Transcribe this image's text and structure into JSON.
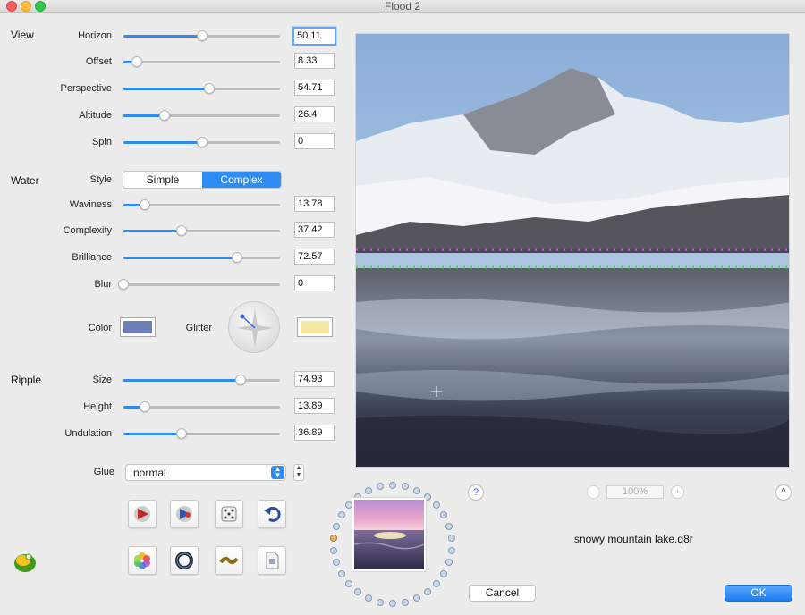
{
  "window": {
    "title": "Flood 2"
  },
  "view": {
    "section_label": "View",
    "rows": [
      {
        "label": "Horizon",
        "value": "50.11",
        "fraction": 0.5011
      },
      {
        "label": "Offset",
        "value": "8.33",
        "fraction": 0.0833
      },
      {
        "label": "Perspective",
        "value": "54.71",
        "fraction": 0.5471
      },
      {
        "label": "Altitude",
        "value": "26.4",
        "fraction": 0.264
      },
      {
        "label": "Spin",
        "value": "0",
        "fraction": 0.5
      }
    ]
  },
  "water": {
    "section_label": "Water",
    "style_label": "Style",
    "style_options": [
      "Simple",
      "Complex"
    ],
    "style_selected": "Complex",
    "rows": [
      {
        "label": "Waviness",
        "value": "13.78",
        "fraction": 0.1378
      },
      {
        "label": "Complexity",
        "value": "37.42",
        "fraction": 0.3742
      },
      {
        "label": "Brilliance",
        "value": "72.57",
        "fraction": 0.7257
      },
      {
        "label": "Blur",
        "value": "0",
        "fraction": 0.0
      }
    ],
    "color_label": "Color",
    "color_value": "#6f7fb8",
    "glitter_label": "Glitter",
    "glitter_value": "#f3eba4"
  },
  "ripple": {
    "section_label": "Ripple",
    "rows": [
      {
        "label": "Size",
        "value": "74.93",
        "fraction": 0.7493
      },
      {
        "label": "Height",
        "value": "13.89",
        "fraction": 0.1389
      },
      {
        "label": "Undulation",
        "value": "36.89",
        "fraction": 0.3689
      }
    ]
  },
  "glue": {
    "label": "Glue",
    "value": "normal"
  },
  "toolbar": {
    "icons": [
      "random-red-icon",
      "random-blue-icon",
      "dice-icon",
      "undo-icon",
      "photos-icon",
      "ring-icon",
      "wave-icon",
      "file-icon"
    ]
  },
  "preview": {
    "help": "?",
    "zoom": "100%",
    "collapse": "^"
  },
  "preset": {
    "filename": "snowy mountain lake.q8r",
    "dot_count": 30,
    "selected_dot": 23
  },
  "buttons": {
    "cancel": "Cancel",
    "ok": "OK"
  },
  "colors": {
    "accent": "#2f8cf5",
    "horizon_line": "#e040e0",
    "offset_line": "#4cd94c"
  }
}
